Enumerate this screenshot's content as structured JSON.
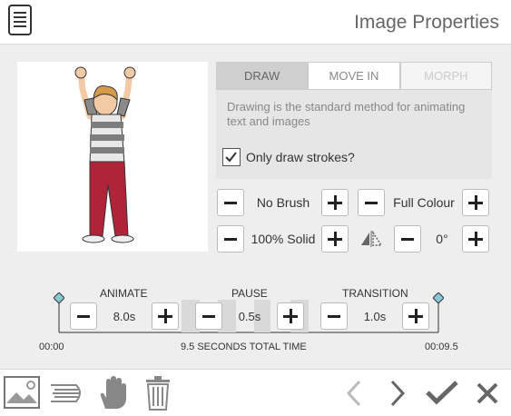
{
  "header": {
    "title": "Image Properties",
    "menu_icon": "menu-icon"
  },
  "tabs": [
    {
      "label": "DRAW",
      "state": "active"
    },
    {
      "label": "MOVE IN",
      "state": "normal"
    },
    {
      "label": "MORPH",
      "state": "disabled"
    }
  ],
  "description": "Drawing is the standard method for animating text and images",
  "only_draw_strokes": {
    "label": "Only draw strokes?",
    "checked": true
  },
  "controls": {
    "brush": "No Brush",
    "colour": "Full Colour",
    "opacity": "100% Solid",
    "rotation": "0°"
  },
  "timeline": {
    "animate": {
      "label": "ANIMATE",
      "value": "8.0s"
    },
    "pause": {
      "label": "PAUSE",
      "value": "0.5s"
    },
    "transition": {
      "label": "TRANSITION",
      "value": "1.0s"
    },
    "start": "00:00",
    "end": "00:09.5",
    "total": "9.5 SECONDS TOTAL TIME"
  },
  "colors": {
    "panel_bg": "#eeeeee",
    "active_tab": "#cfcfcf",
    "accent": "#8cc7d6"
  }
}
